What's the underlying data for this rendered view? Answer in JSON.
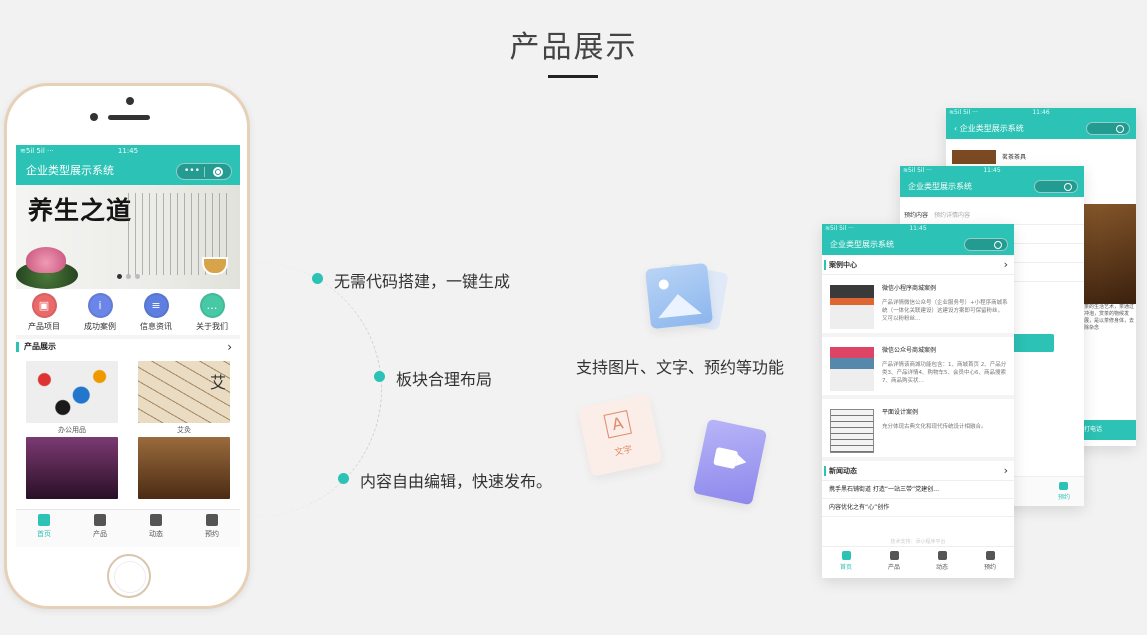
{
  "page_title": "产品展示",
  "phone": {
    "status_left": "≋5il 5il ···",
    "status_time": "11:45",
    "app_title": "企业类型展示系统",
    "banner_calligraphy": "养生之道",
    "quick_nav": [
      {
        "label": "产品项目",
        "icon": "cube-icon",
        "color": "#ea6a6a",
        "glyph": "▣"
      },
      {
        "label": "成功案例",
        "icon": "info-icon",
        "color": "#6b86e8",
        "glyph": "i"
      },
      {
        "label": "信息资讯",
        "icon": "document-icon",
        "color": "#5f7fe0",
        "glyph": "≡"
      },
      {
        "label": "关于我们",
        "icon": "chat-icon",
        "color": "#48c9a6",
        "glyph": "…"
      }
    ],
    "section_title": "产品展示",
    "products": [
      {
        "name": "办公用品"
      },
      {
        "name": "艾灸"
      },
      {
        "name": ""
      },
      {
        "name": ""
      }
    ],
    "tabs": [
      {
        "label": "首页",
        "icon": "home-icon"
      },
      {
        "label": "产品",
        "icon": "box-icon"
      },
      {
        "label": "动态",
        "icon": "news-icon"
      },
      {
        "label": "预约",
        "icon": "message-icon"
      }
    ]
  },
  "features": [
    "无需代码搭建，一键生成",
    "板块合理布局",
    "内容自由编辑，快速发布。"
  ],
  "support_text": "支持图片、文字、预约等功能",
  "deco": {
    "text_card_letter": "A",
    "text_card_word": "文字"
  },
  "mini_back": {
    "status_left": "≋5il 5il ···",
    "time": "11:46",
    "title": "‹  企业类型展示系统",
    "tea_label": "茗茶茶具",
    "side_text": "茶的生活艺术，茶通过冲泡，赏茶的物候发展，是以茶修身体，去除杂念",
    "bottom_text": "打电话"
  },
  "mini_mid": {
    "status_left": "≋5il 5il ···",
    "time": "11:45",
    "title": "企业类型展示系统",
    "form_label": "预约内容",
    "form_placeholder": "预约详情内容",
    "tab_label": "预约"
  },
  "mini_front": {
    "status_left": "≋5il 5il ···",
    "time": "11:45",
    "title": "企业类型展示系统",
    "case_section": "案例中心",
    "cases": [
      {
        "title": "微信小程序商城案例",
        "desc": "产品详情微信公众号（企业服务号）+小程序商城系统（一体化关联建设）这建设方案即可保留粉丝，又可以粉粉丝…"
      },
      {
        "title": "微信公众号商城案例",
        "desc": "产品详情该商城功能包含：1、商城首页 2、产品分类3、产品详情4、购物车5、会员中心6、商品搜索7、商品购买状…"
      },
      {
        "title": "平面设计案例",
        "desc": "充分体现古典文化和现代传统设计相融合。"
      }
    ],
    "news_section": "新闻动态",
    "news": [
      "携手黑石铺街道 打造“一站三带”党建创…",
      "内容优化之有“心”创作"
    ],
    "footer_note": "技术支持：添小程序平台",
    "tabs": [
      "首页",
      "产品",
      "动态",
      "预约"
    ]
  }
}
